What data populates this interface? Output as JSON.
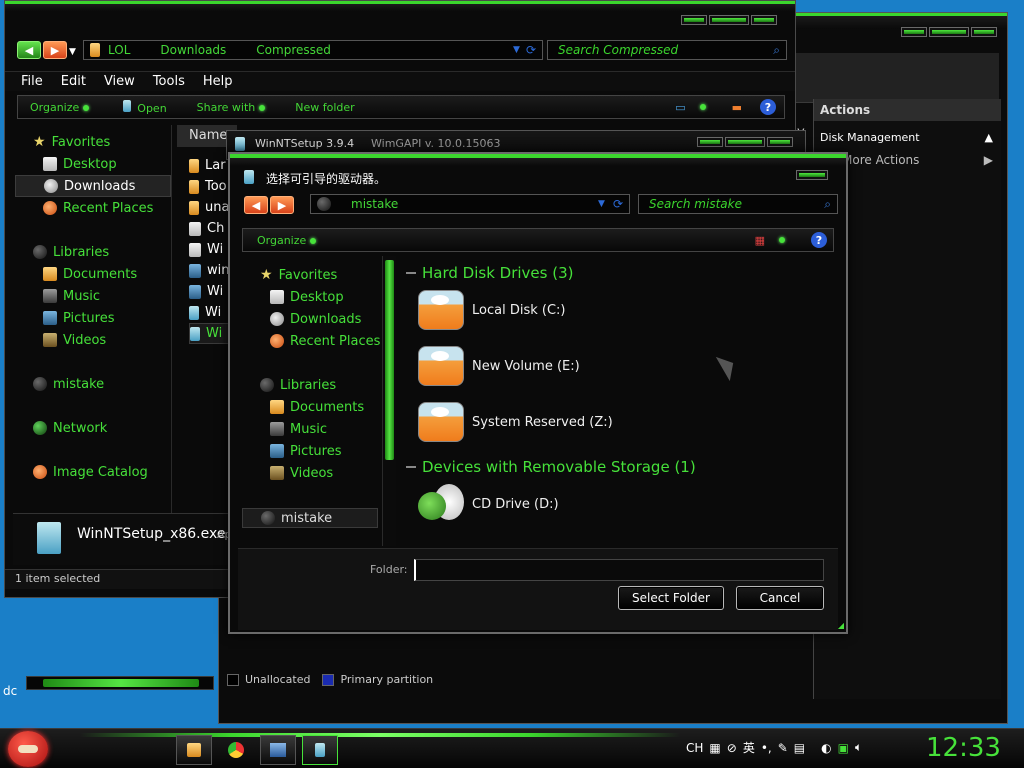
{
  "explorer": {
    "breadcrumbs": [
      "LOL",
      "Downloads",
      "Compressed"
    ],
    "search_placeholder": "Search Compressed",
    "menu": [
      "File",
      "Edit",
      "View",
      "Tools",
      "Help"
    ],
    "toolbar": {
      "organize": "Organize",
      "open": "Open",
      "share_with": "Share with",
      "new_folder": "New folder"
    },
    "column_name": "Name",
    "nav": {
      "favorites": "Favorites",
      "favorites_items": [
        "Desktop",
        "Downloads",
        "Recent Places"
      ],
      "libraries": "Libraries",
      "libraries_items": [
        "Documents",
        "Music",
        "Pictures",
        "Videos"
      ],
      "homegroup": "mistake",
      "network": "Network",
      "image_catalog": "Image Catalog"
    },
    "files": [
      "Lar",
      "Too",
      "una",
      "Ch",
      "Wi",
      "win",
      "Wi",
      "Wi",
      "Wi"
    ],
    "details_filename": "WinNTSetup_x86.exe",
    "details_type_fragment": "Ap",
    "status": "1 item selected"
  },
  "disk_mgmt": {
    "actions_title": "Actions",
    "disk_management": "Disk Management",
    "more_actions": "More Actions",
    "legend_unallocated": "Unallocated",
    "legend_primary": "Primary partition",
    "clipped_text": "y",
    "desktop_text": "dc"
  },
  "winnt": {
    "title": "WinNTSetup 3.9.4",
    "wimgapi": "WimGAPI v. 10.0.15063"
  },
  "dialog": {
    "title": "选择可引导的驱动器。",
    "address": "mistake",
    "search_placeholder": "Search mistake",
    "organize": "Organize",
    "nav": {
      "favorites": "Favorites",
      "favorites_items": [
        "Desktop",
        "Downloads",
        "Recent Places"
      ],
      "libraries": "Libraries",
      "libraries_items": [
        "Documents",
        "Music",
        "Pictures",
        "Videos"
      ],
      "homegroup": "mistake"
    },
    "group_hdd": "Hard Disk Drives (3)",
    "drives": [
      "Local Disk (C:)",
      "New Volume (E:)",
      "System Reserved (Z:)"
    ],
    "group_removable": "Devices with Removable Storage (1)",
    "cd_drive": "CD Drive (D:)",
    "folder_label": "Folder:",
    "folder_value": "",
    "select_button": "Select Folder",
    "cancel_button": "Cancel"
  },
  "taskbar": {
    "lang": "CH",
    "ime": "英",
    "clock": "12:33"
  }
}
